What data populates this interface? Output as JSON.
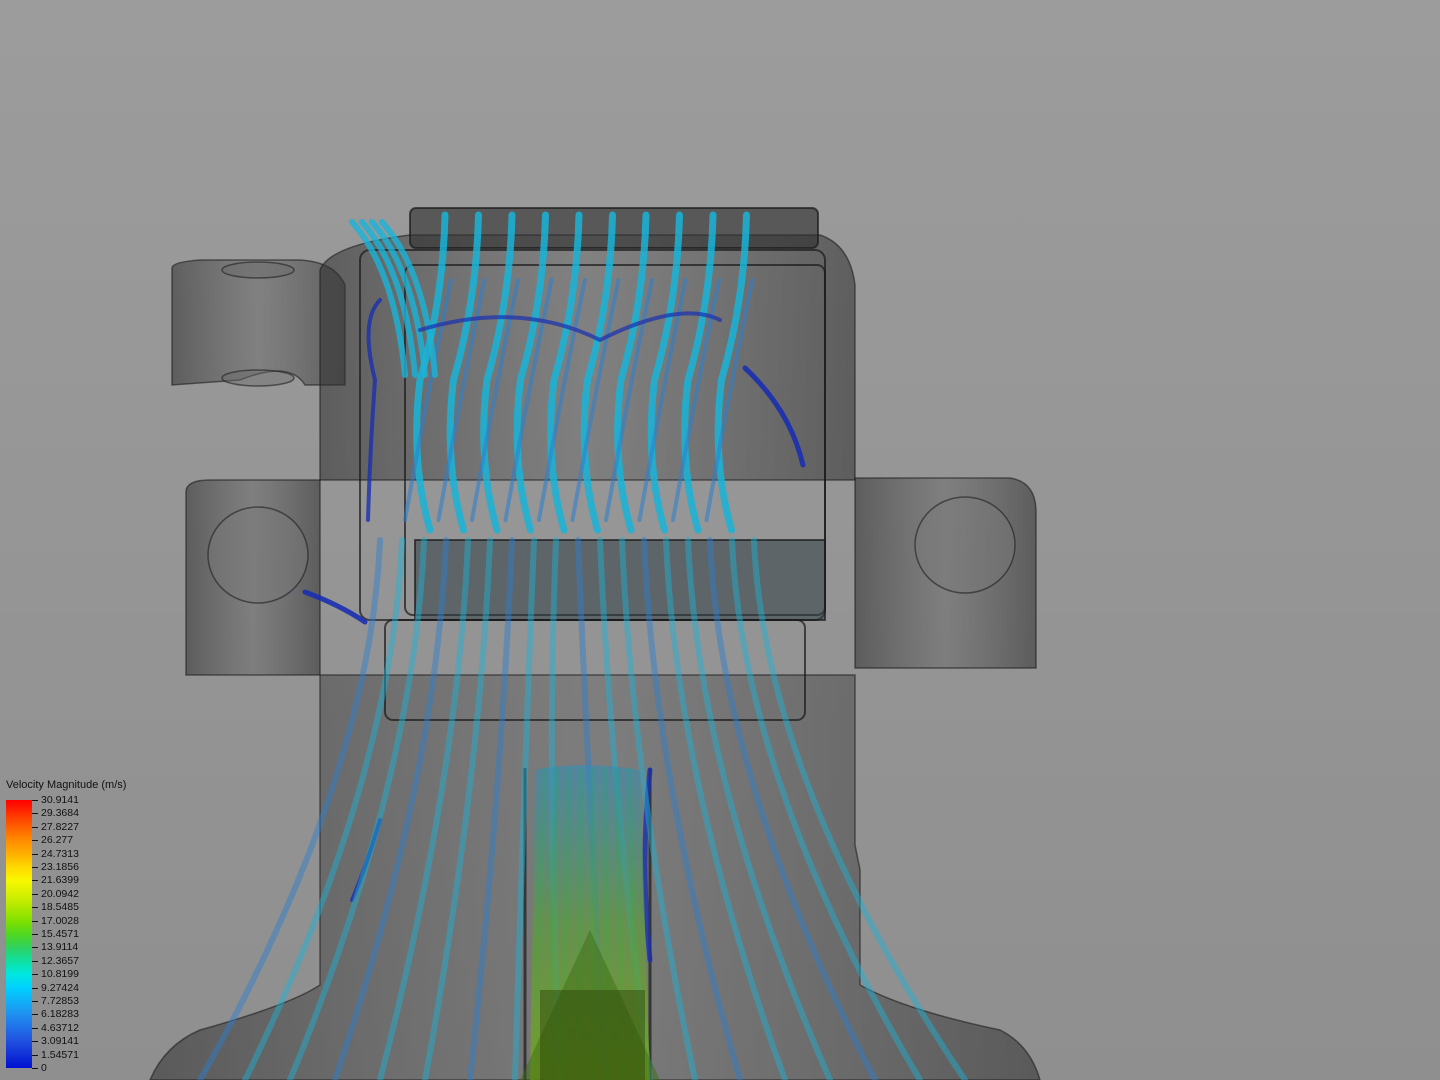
{
  "legend": {
    "title": "Velocity Magnitude (m/s)",
    "labels": [
      "30.9141",
      "29.3684",
      "27.8227",
      "26.277",
      "24.7313",
      "23.1856",
      "21.6399",
      "20.0942",
      "18.5485",
      "17.0028",
      "15.4571",
      "13.9114",
      "12.3657",
      "10.8199",
      "9.27424",
      "7.72853",
      "6.18283",
      "4.63712",
      "3.09141",
      "1.54571",
      "0"
    ],
    "colors": [
      "#ff0000",
      "#ff3000",
      "#ff6000",
      "#ff8a00",
      "#ffb000",
      "#ffd800",
      "#f8f800",
      "#d8f000",
      "#b0e800",
      "#80e000",
      "#50d820",
      "#30d060",
      "#10e0a0",
      "#00e8e0",
      "#00d0ff",
      "#10b0f8",
      "#2090f0",
      "#2070e8",
      "#2050e0",
      "#1030d8",
      "#0010d0"
    ]
  },
  "scene": {
    "background": "#9a9a9a",
    "body_color": "#3a3a3a",
    "streamline_colors": [
      "#18b4d8",
      "#2a7fd0",
      "#1a2fb0",
      "#3aa060",
      "#70b020"
    ]
  }
}
